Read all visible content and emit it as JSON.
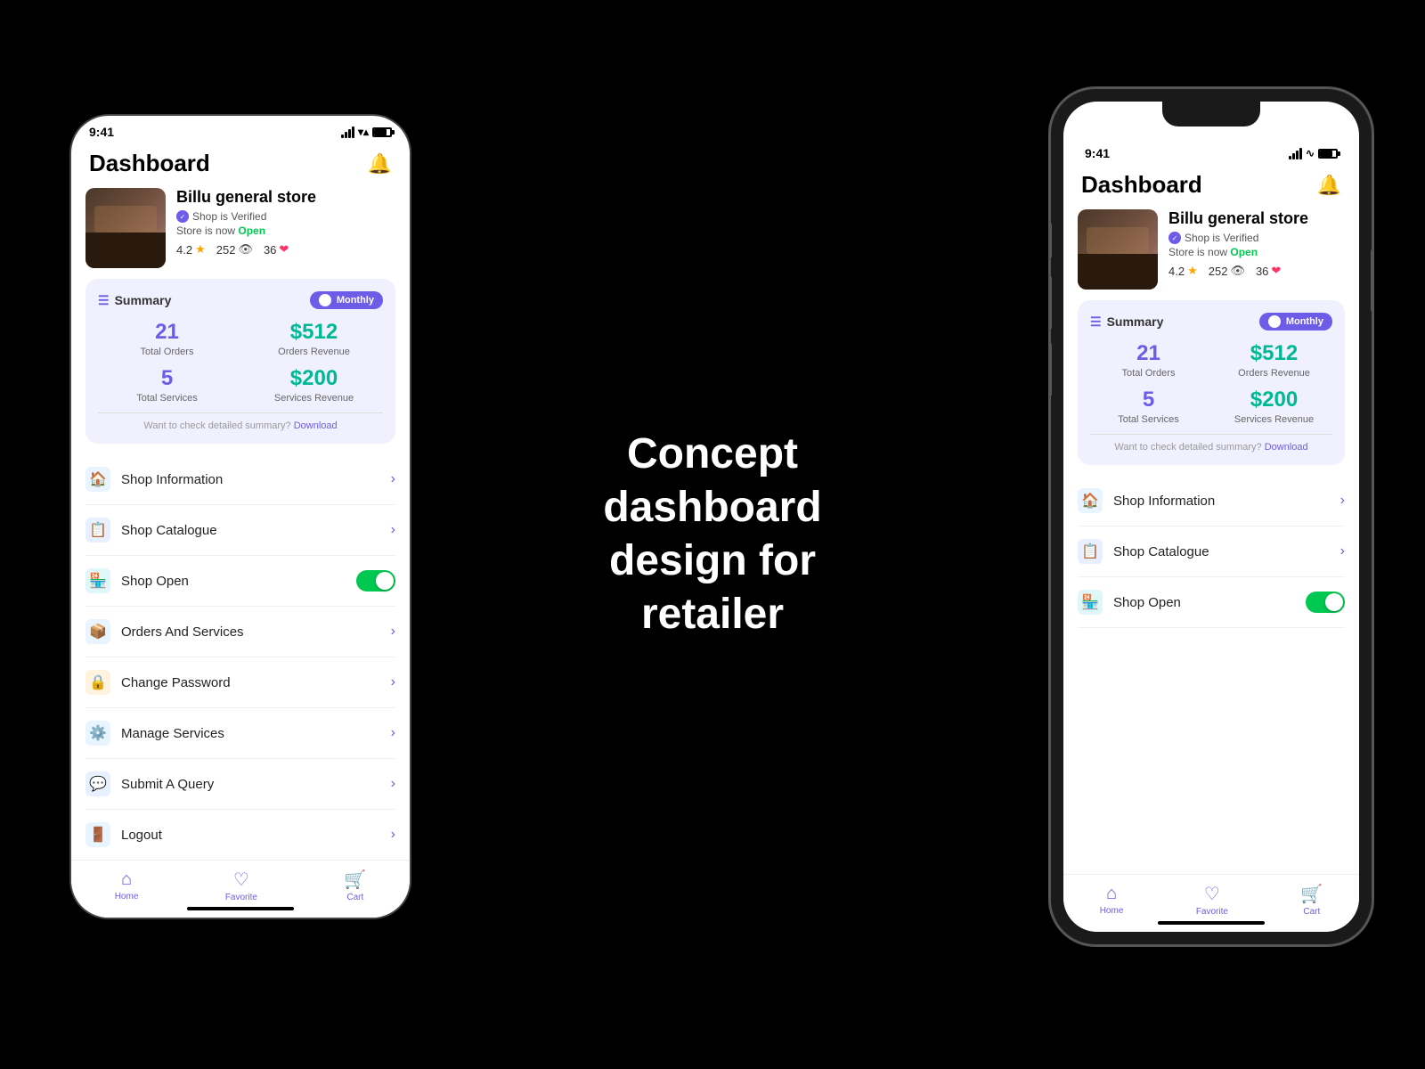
{
  "center_text": {
    "line1": "Concept dashboard",
    "line2": "design for retailer"
  },
  "left_phone": {
    "status_bar": {
      "time": "9:41"
    },
    "header": {
      "title": "Dashboard",
      "bell_label": "notifications"
    },
    "store": {
      "name": "Billu general store",
      "verified_text": "Shop is Verified",
      "status_prefix": "Store is now ",
      "status_open": "Open",
      "rating": "4.2",
      "views": "252",
      "likes": "36"
    },
    "summary": {
      "label": "Summary",
      "toggle_label": "Monthly",
      "total_orders_value": "21",
      "total_orders_key": "Total Orders",
      "orders_revenue_value": "$512",
      "orders_revenue_key": "Orders Revenue",
      "total_services_value": "5",
      "total_services_key": "Total Services",
      "services_revenue_value": "$200",
      "services_revenue_key": "Services Revenue",
      "footer_text": "Want to check detailed summary?",
      "download_text": "Download"
    },
    "menu": [
      {
        "id": "shop-information",
        "label": "Shop Information",
        "icon": "🏠",
        "type": "arrow",
        "icon_class": "menu-icon-home"
      },
      {
        "id": "shop-catalogue",
        "label": "Shop Catalogue",
        "icon": "📋",
        "type": "arrow",
        "icon_class": "menu-icon-catalogue"
      },
      {
        "id": "shop-open",
        "label": "Shop Open",
        "icon": "🏪",
        "type": "toggle",
        "icon_class": "menu-icon-shop"
      },
      {
        "id": "orders-services",
        "label": "Orders And Services",
        "icon": "📦",
        "type": "arrow",
        "icon_class": "menu-icon-orders"
      },
      {
        "id": "change-password",
        "label": "Change Password",
        "icon": "🔒",
        "type": "arrow",
        "icon_class": "menu-icon-password"
      },
      {
        "id": "manage-services",
        "label": "Manage Services",
        "icon": "⚙️",
        "type": "arrow",
        "icon_class": "menu-icon-services"
      },
      {
        "id": "submit-query",
        "label": "Submit A Query",
        "icon": "💬",
        "type": "arrow",
        "icon_class": "menu-icon-query"
      },
      {
        "id": "logout",
        "label": "Logout",
        "icon": "🚪",
        "type": "arrow",
        "icon_class": "menu-icon-logout"
      }
    ],
    "bottom_nav": [
      {
        "id": "home",
        "label": "Home",
        "icon": "⊞"
      },
      {
        "id": "favorite",
        "label": "Favorite",
        "icon": "♡"
      },
      {
        "id": "cart",
        "label": "Cart",
        "icon": "⊡"
      }
    ]
  },
  "right_phone": {
    "status_bar": {
      "time": "9:41"
    },
    "header": {
      "title": "Dashboard"
    },
    "store": {
      "name": "Billu general store",
      "verified_text": "Shop is Verified",
      "status_prefix": "Store is now ",
      "status_open": "Open",
      "rating": "4.2",
      "views": "252",
      "likes": "36"
    },
    "summary": {
      "label": "Summary",
      "toggle_label": "Monthly",
      "total_orders_value": "21",
      "total_orders_key": "Total Orders",
      "orders_revenue_value": "$512",
      "orders_revenue_key": "Orders Revenue",
      "total_services_value": "5",
      "total_services_key": "Total Services",
      "services_revenue_value": "$200",
      "services_revenue_key": "Services Revenue",
      "footer_text": "Want to check detailed summary?",
      "download_text": "Download"
    },
    "menu": [
      {
        "id": "shop-information",
        "label": "Shop Information",
        "icon": "🏠",
        "type": "arrow",
        "icon_class": "menu-icon-home"
      },
      {
        "id": "shop-catalogue",
        "label": "Shop Catalogue",
        "icon": "📋",
        "type": "arrow",
        "icon_class": "menu-icon-catalogue"
      },
      {
        "id": "shop-open",
        "label": "Shop Open",
        "icon": "🏪",
        "type": "toggle",
        "icon_class": "menu-icon-shop"
      }
    ],
    "bottom_nav": [
      {
        "id": "home",
        "label": "Home",
        "icon": "⊞"
      },
      {
        "id": "favorite",
        "label": "Favorite",
        "icon": "♡"
      },
      {
        "id": "cart",
        "label": "Cart",
        "icon": "⊡"
      }
    ]
  }
}
